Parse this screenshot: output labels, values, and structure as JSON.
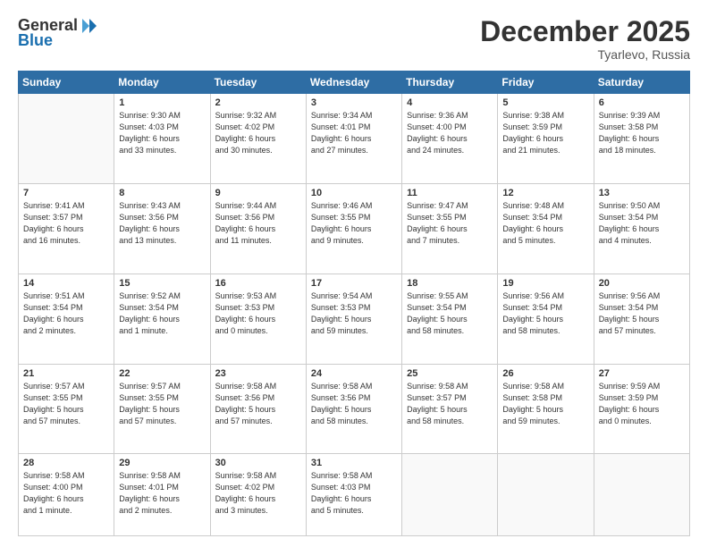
{
  "logo": {
    "general": "General",
    "blue": "Blue"
  },
  "header": {
    "month": "December 2025",
    "location": "Tyarlevo, Russia"
  },
  "weekdays": [
    "Sunday",
    "Monday",
    "Tuesday",
    "Wednesday",
    "Thursday",
    "Friday",
    "Saturday"
  ],
  "days": [
    {
      "day": "",
      "info": ""
    },
    {
      "day": "1",
      "info": "Sunrise: 9:30 AM\nSunset: 4:03 PM\nDaylight: 6 hours\nand 33 minutes."
    },
    {
      "day": "2",
      "info": "Sunrise: 9:32 AM\nSunset: 4:02 PM\nDaylight: 6 hours\nand 30 minutes."
    },
    {
      "day": "3",
      "info": "Sunrise: 9:34 AM\nSunset: 4:01 PM\nDaylight: 6 hours\nand 27 minutes."
    },
    {
      "day": "4",
      "info": "Sunrise: 9:36 AM\nSunset: 4:00 PM\nDaylight: 6 hours\nand 24 minutes."
    },
    {
      "day": "5",
      "info": "Sunrise: 9:38 AM\nSunset: 3:59 PM\nDaylight: 6 hours\nand 21 minutes."
    },
    {
      "day": "6",
      "info": "Sunrise: 9:39 AM\nSunset: 3:58 PM\nDaylight: 6 hours\nand 18 minutes."
    },
    {
      "day": "7",
      "info": "Sunrise: 9:41 AM\nSunset: 3:57 PM\nDaylight: 6 hours\nand 16 minutes."
    },
    {
      "day": "8",
      "info": "Sunrise: 9:43 AM\nSunset: 3:56 PM\nDaylight: 6 hours\nand 13 minutes."
    },
    {
      "day": "9",
      "info": "Sunrise: 9:44 AM\nSunset: 3:56 PM\nDaylight: 6 hours\nand 11 minutes."
    },
    {
      "day": "10",
      "info": "Sunrise: 9:46 AM\nSunset: 3:55 PM\nDaylight: 6 hours\nand 9 minutes."
    },
    {
      "day": "11",
      "info": "Sunrise: 9:47 AM\nSunset: 3:55 PM\nDaylight: 6 hours\nand 7 minutes."
    },
    {
      "day": "12",
      "info": "Sunrise: 9:48 AM\nSunset: 3:54 PM\nDaylight: 6 hours\nand 5 minutes."
    },
    {
      "day": "13",
      "info": "Sunrise: 9:50 AM\nSunset: 3:54 PM\nDaylight: 6 hours\nand 4 minutes."
    },
    {
      "day": "14",
      "info": "Sunrise: 9:51 AM\nSunset: 3:54 PM\nDaylight: 6 hours\nand 2 minutes."
    },
    {
      "day": "15",
      "info": "Sunrise: 9:52 AM\nSunset: 3:54 PM\nDaylight: 6 hours\nand 1 minute."
    },
    {
      "day": "16",
      "info": "Sunrise: 9:53 AM\nSunset: 3:53 PM\nDaylight: 6 hours\nand 0 minutes."
    },
    {
      "day": "17",
      "info": "Sunrise: 9:54 AM\nSunset: 3:53 PM\nDaylight: 5 hours\nand 59 minutes."
    },
    {
      "day": "18",
      "info": "Sunrise: 9:55 AM\nSunset: 3:54 PM\nDaylight: 5 hours\nand 58 minutes."
    },
    {
      "day": "19",
      "info": "Sunrise: 9:56 AM\nSunset: 3:54 PM\nDaylight: 5 hours\nand 58 minutes."
    },
    {
      "day": "20",
      "info": "Sunrise: 9:56 AM\nSunset: 3:54 PM\nDaylight: 5 hours\nand 57 minutes."
    },
    {
      "day": "21",
      "info": "Sunrise: 9:57 AM\nSunset: 3:55 PM\nDaylight: 5 hours\nand 57 minutes."
    },
    {
      "day": "22",
      "info": "Sunrise: 9:57 AM\nSunset: 3:55 PM\nDaylight: 5 hours\nand 57 minutes."
    },
    {
      "day": "23",
      "info": "Sunrise: 9:58 AM\nSunset: 3:56 PM\nDaylight: 5 hours\nand 57 minutes."
    },
    {
      "day": "24",
      "info": "Sunrise: 9:58 AM\nSunset: 3:56 PM\nDaylight: 5 hours\nand 58 minutes."
    },
    {
      "day": "25",
      "info": "Sunrise: 9:58 AM\nSunset: 3:57 PM\nDaylight: 5 hours\nand 58 minutes."
    },
    {
      "day": "26",
      "info": "Sunrise: 9:58 AM\nSunset: 3:58 PM\nDaylight: 5 hours\nand 59 minutes."
    },
    {
      "day": "27",
      "info": "Sunrise: 9:59 AM\nSunset: 3:59 PM\nDaylight: 6 hours\nand 0 minutes."
    },
    {
      "day": "28",
      "info": "Sunrise: 9:58 AM\nSunset: 4:00 PM\nDaylight: 6 hours\nand 1 minute."
    },
    {
      "day": "29",
      "info": "Sunrise: 9:58 AM\nSunset: 4:01 PM\nDaylight: 6 hours\nand 2 minutes."
    },
    {
      "day": "30",
      "info": "Sunrise: 9:58 AM\nSunset: 4:02 PM\nDaylight: 6 hours\nand 3 minutes."
    },
    {
      "day": "31",
      "info": "Sunrise: 9:58 AM\nSunset: 4:03 PM\nDaylight: 6 hours\nand 5 minutes."
    }
  ]
}
